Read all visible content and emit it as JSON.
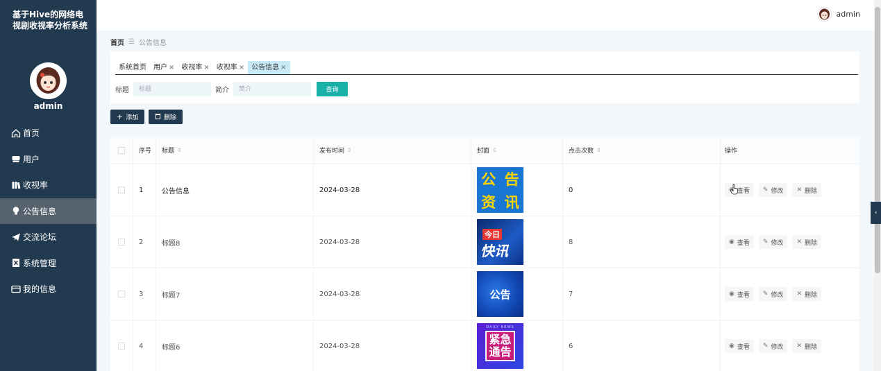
{
  "app": {
    "title": "基于Hive的网络电视剧收视率分析系统",
    "username": "admin"
  },
  "header": {
    "username": "admin"
  },
  "sidebar": {
    "items": [
      {
        "label": "首页",
        "icon": "home-icon",
        "active": false
      },
      {
        "label": "用户",
        "icon": "user-icon",
        "active": false
      },
      {
        "label": "收视率",
        "icon": "book-icon",
        "active": false
      },
      {
        "label": "公告信息",
        "icon": "bulb-icon",
        "active": true
      },
      {
        "label": "交流论坛",
        "icon": "send-icon",
        "active": false
      },
      {
        "label": "系统管理",
        "icon": "doc-icon",
        "active": false
      },
      {
        "label": "我的信息",
        "icon": "card-icon",
        "active": false
      }
    ]
  },
  "breadcrumb": {
    "home": "首页",
    "separator": "☰",
    "current": "公告信息"
  },
  "tabs": [
    {
      "label": "系统首页",
      "closable": false,
      "active": false
    },
    {
      "label": "用户",
      "closable": true,
      "active": false
    },
    {
      "label": "收视率",
      "closable": true,
      "active": false
    },
    {
      "label": "收视率",
      "closable": true,
      "active": false
    },
    {
      "label": "公告信息",
      "closable": true,
      "active": true
    }
  ],
  "search": {
    "title_label": "标题",
    "title_placeholder": "标题",
    "intro_label": "简介",
    "intro_placeholder": "简介",
    "button": "查询"
  },
  "actions": {
    "add": "添加",
    "delete": "删除"
  },
  "table": {
    "headers": {
      "no": "序号",
      "title": "标题",
      "time": "发布时间",
      "cover": "封面",
      "clicks": "点击次数",
      "ops": "操作"
    },
    "op_labels": {
      "view": "查看",
      "edit": "修改",
      "delete": "删除"
    },
    "rows": [
      {
        "no": "1",
        "title": "公告信息",
        "time": "2024-03-28",
        "clicks": "0",
        "cover_text": [
          "公",
          "告",
          "资",
          "讯"
        ]
      },
      {
        "no": "2",
        "title": "标题8",
        "time": "2024-03-28",
        "clicks": "8",
        "cover_text": [
          "今日",
          "快讯"
        ]
      },
      {
        "no": "3",
        "title": "标题7",
        "time": "2024-03-28",
        "clicks": "7",
        "cover_text": [
          "公告"
        ]
      },
      {
        "no": "4",
        "title": "标题6",
        "time": "2024-03-28",
        "clicks": "6",
        "cover_text": [
          "DAILY NEWS",
          "紧急",
          "通告"
        ]
      }
    ]
  },
  "colors": {
    "sidebar": "#223a4f",
    "accent": "#1bb1ab",
    "active_tab": "#c8eaf6"
  }
}
